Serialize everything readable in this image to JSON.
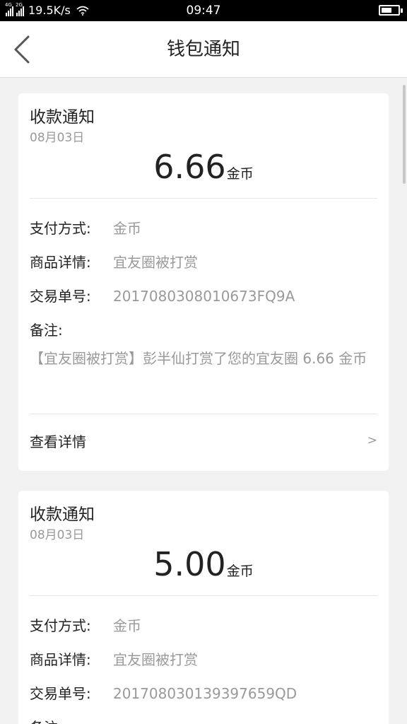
{
  "status_bar": {
    "network_speed": "19.5K/s",
    "time": "09:47",
    "signal_tags": [
      "4G",
      "2G"
    ],
    "icons": [
      "signal-icon",
      "signal-icon",
      "wifi-icon",
      "battery-icon"
    ]
  },
  "header": {
    "title": "钱包通知",
    "back_icon": "chevron-left-icon"
  },
  "notifications": [
    {
      "title": "收款通知",
      "date": "08月03日",
      "amount": "6.66",
      "unit": "金币",
      "payment_method_label": "支付方式:",
      "payment_method": "金币",
      "product_label": "商品详情:",
      "product": "宜友圈被打赏",
      "txn_label": "交易单号:",
      "txn": "2017080308010673FQ9A",
      "remark_label": "备注:",
      "remark": "【宜友圈被打赏】彭半仙打赏了您的宜友圈 6.66 金币",
      "detail_label": "查看详情",
      "detail_chevron": ">"
    },
    {
      "title": "收款通知",
      "date": "08月03日",
      "amount": "5.00",
      "unit": "金币",
      "payment_method_label": "支付方式:",
      "payment_method": "金币",
      "product_label": "商品详情:",
      "product": "宜友圈被打赏",
      "txn_label": "交易单号:",
      "txn": "20170803013939765​9QD",
      "remark_label": "备注:"
    }
  ],
  "colors": {
    "background": "#f2f2f2",
    "card": "#ffffff",
    "primary_text": "#222222",
    "secondary_text": "#999999"
  }
}
